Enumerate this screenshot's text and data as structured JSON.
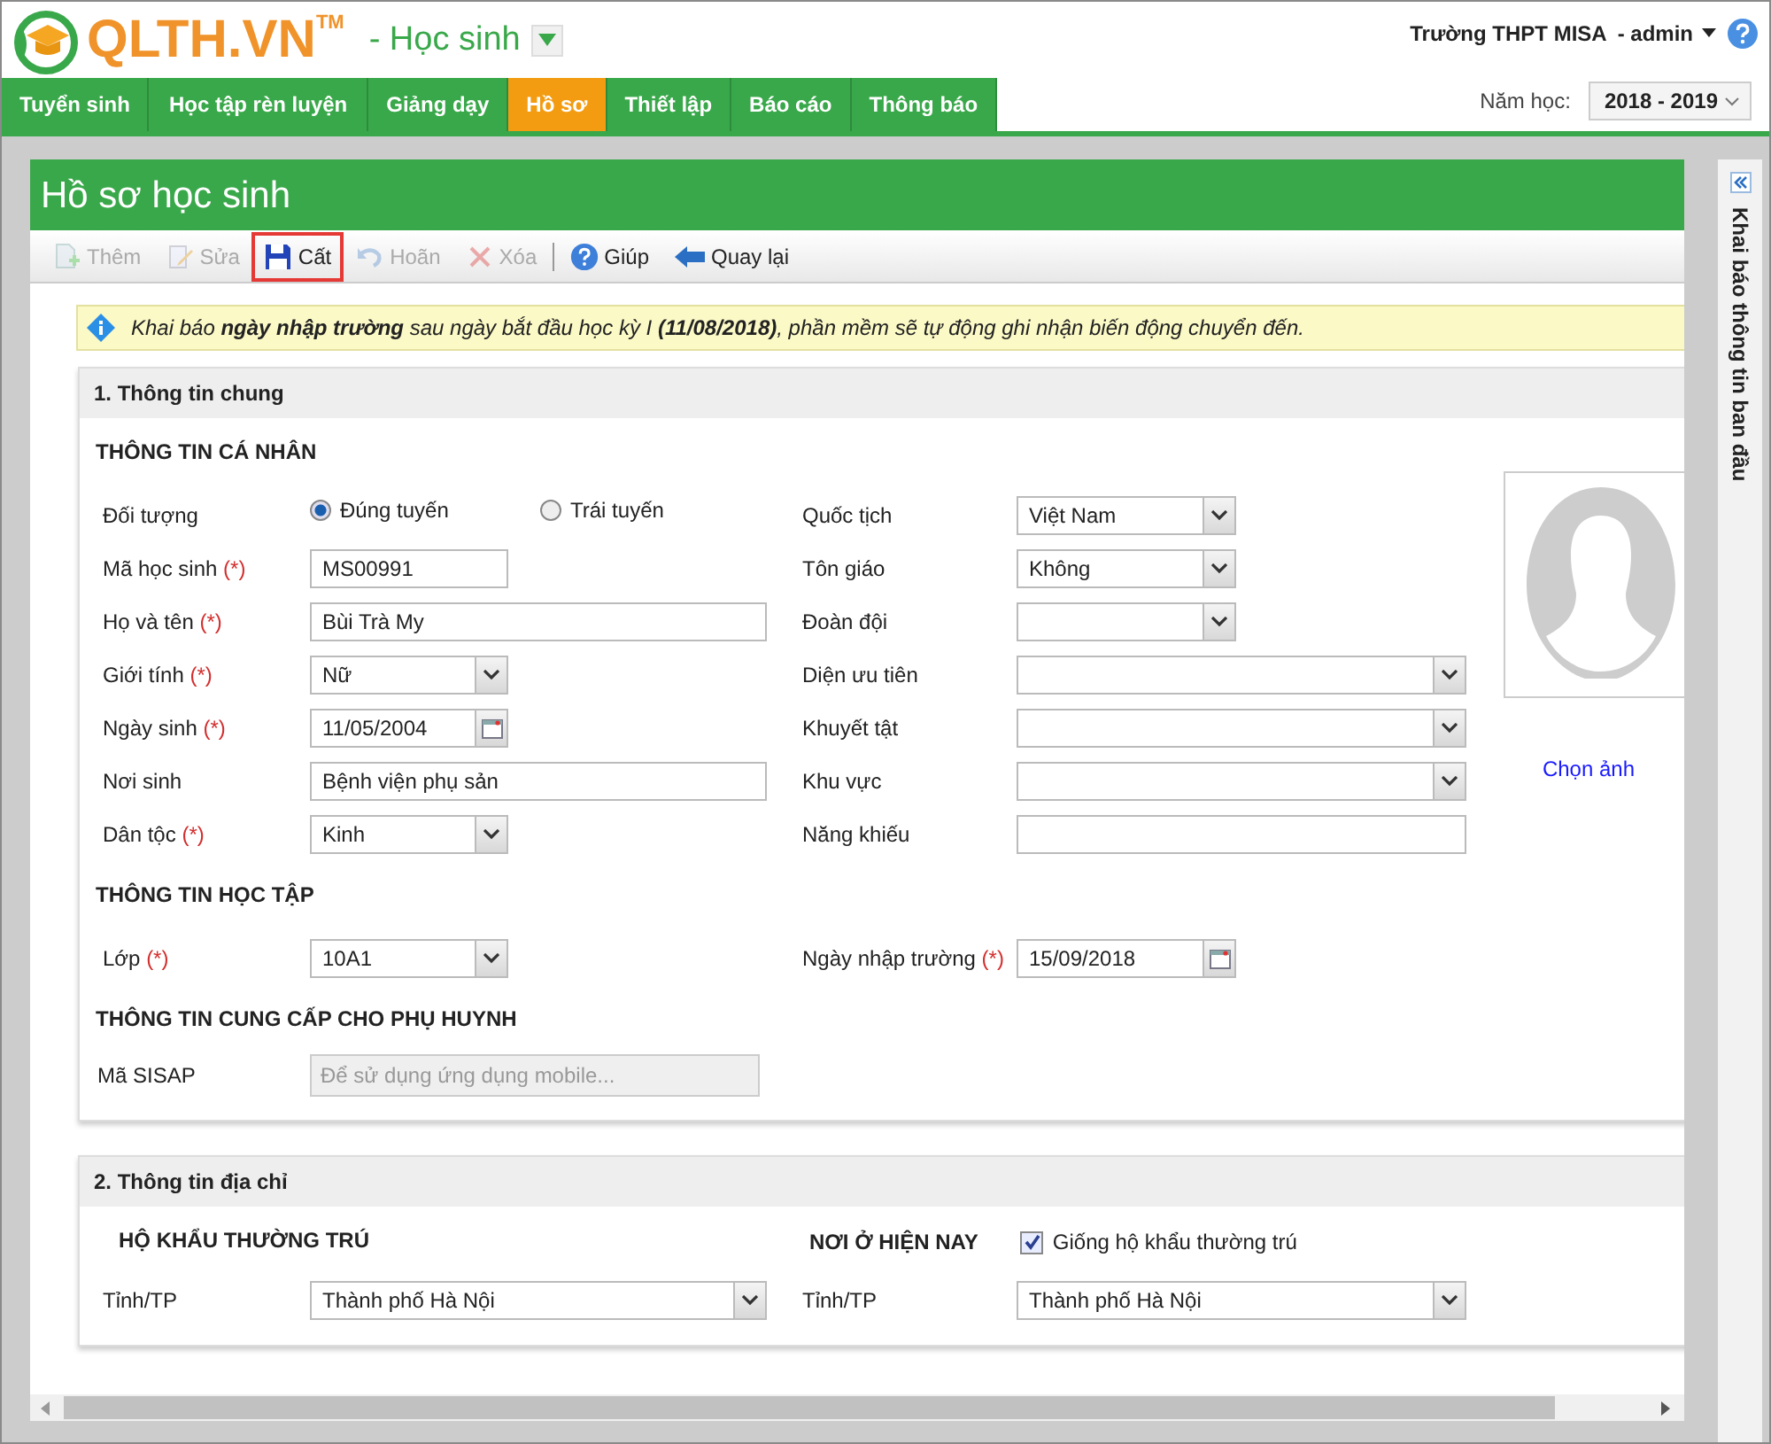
{
  "header": {
    "logo": "QLTH.VN",
    "trademark": "TM",
    "module": "- Học sinh",
    "school": "Trường THPT MISA",
    "user": "- admin"
  },
  "nav": {
    "tabs": [
      {
        "label": "Tuyển sinh",
        "selected": false
      },
      {
        "label": "Học tập rèn luyện",
        "selected": false
      },
      {
        "label": "Giảng dạy",
        "selected": false
      },
      {
        "label": "Hồ sơ",
        "selected": true
      },
      {
        "label": "Thiết lập",
        "selected": false
      },
      {
        "label": "Báo cáo",
        "selected": false
      },
      {
        "label": "Thông báo",
        "selected": false
      }
    ],
    "year_label": "Năm học:",
    "year": "2018 - 2019"
  },
  "page_title": "Hồ sơ học sinh",
  "toolbar": [
    {
      "kind": "add",
      "label": "Thêm",
      "disabled": true,
      "selected": false
    },
    {
      "kind": "edit",
      "label": "Sửa",
      "disabled": true,
      "selected": false
    },
    {
      "kind": "save",
      "label": "Cất",
      "disabled": false,
      "selected": true
    },
    {
      "kind": "undo",
      "label": "Hoãn",
      "disabled": true,
      "selected": false
    },
    {
      "kind": "delete",
      "label": "Xóa",
      "disabled": true,
      "selected": false
    },
    {
      "kind": "separator"
    },
    {
      "kind": "help",
      "label": "Giúp",
      "disabled": false,
      "selected": false
    },
    {
      "kind": "back",
      "label": "Quay lại",
      "disabled": false,
      "selected": false
    }
  ],
  "notice": "Khai báo **ngày nhập trường** sau ngày bắt đầu học kỳ I **(11/08/2018)**, phần mềm sẽ tự động ghi nhận biến động chuyển đến.",
  "side_panel": {
    "title": "Khai báo thông tin ban đầu"
  },
  "general": {
    "title": "1. Thông tin chung",
    "personal": {
      "heading": "THÔNG TIN CÁ NHÂN",
      "left": [
        {
          "label": "Đối tượng",
          "kind": "radio",
          "options": [
            {
              "label": "Đúng tuyến",
              "selected": true
            },
            {
              "label": "Trái tuyến",
              "selected": false
            }
          ]
        },
        {
          "label": "Mã học sinh",
          "required_mark": "(*)",
          "kind": "text",
          "value": "MS00991",
          "wide": false
        },
        {
          "label": "Họ và tên",
          "required_mark": "(*)",
          "kind": "text",
          "value": "Bùi Trà My",
          "wide": true
        },
        {
          "label": "Giới tính",
          "required_mark": "(*)",
          "kind": "select",
          "value": "Nữ",
          "wide": false
        },
        {
          "label": "Ngày sinh",
          "required_mark": "(*)",
          "kind": "date",
          "value": "11/05/2004",
          "wide": false
        },
        {
          "label": "Nơi sinh",
          "kind": "text",
          "value": "Bệnh viện phụ sản",
          "wide": true
        },
        {
          "label": "Dân tộc",
          "required_mark": "(*)",
          "kind": "select",
          "value": "Kinh",
          "wide": false
        }
      ],
      "right": [
        {
          "label": "Quốc tịch",
          "kind": "select",
          "value": "Việt Nam",
          "wide": false
        },
        {
          "label": "Tôn giáo",
          "kind": "select",
          "value": "Không",
          "wide": false
        },
        {
          "label": "Đoàn đội",
          "kind": "select",
          "wide": false
        },
        {
          "label": "Diện ưu tiên",
          "kind": "select",
          "wide": true
        },
        {
          "label": "Khuyết tật",
          "kind": "select",
          "wide": true
        },
        {
          "label": "Khu vực",
          "kind": "select",
          "wide": true
        },
        {
          "label": "Năng khiếu",
          "kind": "text",
          "wide": true
        }
      ],
      "photo_link": "Chọn ảnh"
    },
    "study": {
      "heading": "THÔNG TIN HỌC TẬP",
      "left": [
        {
          "label": "Lớp",
          "required_mark": "(*)",
          "kind": "select",
          "value": "10A1",
          "wide": false
        }
      ],
      "right": [
        {
          "label": "Ngày nhập trường",
          "required_mark": "(*)",
          "kind": "date",
          "value": "15/09/2018",
          "wide": false
        }
      ]
    },
    "parent": {
      "heading": "THÔNG TIN CUNG CẤP CHO PHỤ HUYNH",
      "field": {
        "label": "Mã SISAP",
        "placeholder": "Để sử dụng ứng dụng mobile...",
        "disabled": true
      }
    }
  },
  "address": {
    "title": "2. Thông tin địa chỉ",
    "permanent": {
      "heading": "HỘ KHẨU THƯỜNG TRÚ",
      "fields": [
        {
          "label": "Tỉnh/TP",
          "kind": "select",
          "value": "Thành phố Hà Nội",
          "wide": true
        }
      ]
    },
    "current": {
      "heading": "NƠI Ở HIỆN NAY",
      "same": {
        "label": "Giống hộ khẩu thường trú",
        "checked": true
      },
      "fields": [
        {
          "label": "Tỉnh/TP",
          "kind": "select",
          "value": "Thành phố Hà Nội",
          "wide": true
        }
      ]
    }
  }
}
